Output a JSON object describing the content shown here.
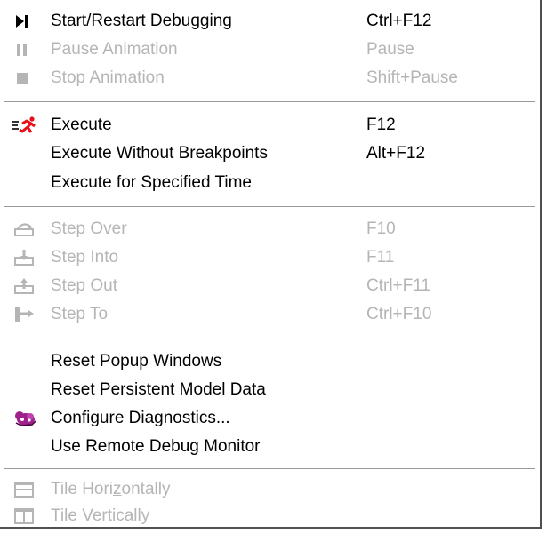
{
  "menu": {
    "groups": [
      {
        "items": [
          {
            "label": "Start/Restart Debugging",
            "shortcut": "Ctrl+F12",
            "icon": "play-to-end-icon",
            "enabled": true
          },
          {
            "label": "Pause Animation",
            "shortcut": "Pause",
            "icon": "pause-icon",
            "enabled": false
          },
          {
            "label": "Stop Animation",
            "shortcut": "Shift+Pause",
            "icon": "stop-icon",
            "enabled": false
          }
        ]
      },
      {
        "items": [
          {
            "label": "Execute",
            "shortcut": "F12",
            "icon": "running-man-icon",
            "enabled": true
          },
          {
            "label": "Execute Without Breakpoints",
            "shortcut": "Alt+F12",
            "icon": "",
            "enabled": true
          },
          {
            "label": "Execute for Specified Time",
            "shortcut": "",
            "icon": "",
            "enabled": true
          }
        ]
      },
      {
        "items": [
          {
            "label": "Step Over",
            "shortcut": "F10",
            "icon": "step-over-icon",
            "enabled": false
          },
          {
            "label": "Step Into",
            "shortcut": "F11",
            "icon": "step-into-icon",
            "enabled": false
          },
          {
            "label": "Step Out",
            "shortcut": "Ctrl+F11",
            "icon": "step-out-icon",
            "enabled": false
          },
          {
            "label": "Step To",
            "shortcut": "Ctrl+F10",
            "icon": "step-to-icon",
            "enabled": false
          }
        ]
      },
      {
        "items": [
          {
            "label": "Reset Popup Windows",
            "shortcut": "",
            "icon": "",
            "enabled": true
          },
          {
            "label": "Reset Persistent Model Data",
            "shortcut": "",
            "icon": "",
            "enabled": true
          },
          {
            "label": "Configure Diagnostics...",
            "shortcut": "",
            "icon": "diagnostics-icon",
            "enabled": true
          },
          {
            "label": "Use Remote Debug Monitor",
            "shortcut": "",
            "icon": "",
            "enabled": true
          }
        ]
      },
      {
        "items": [
          {
            "label": "Tile Horizontally",
            "label_before": "Tile Hori",
            "mnemonic": "z",
            "label_after": "ontally",
            "shortcut": "",
            "icon": "tile-horizontal-icon",
            "enabled": false
          },
          {
            "label": "Tile Vertically",
            "label_before": "Tile ",
            "mnemonic": "V",
            "label_after": "ertically",
            "shortcut": "",
            "icon": "tile-vertical-icon",
            "enabled": false
          }
        ]
      }
    ]
  },
  "colors": {
    "text": "#000000",
    "disabled_text": "#b5b5b5",
    "separator": "#9a9a9a",
    "execute_icon_red": "#e8101a",
    "diagnostics_icon": "#a0208c"
  }
}
